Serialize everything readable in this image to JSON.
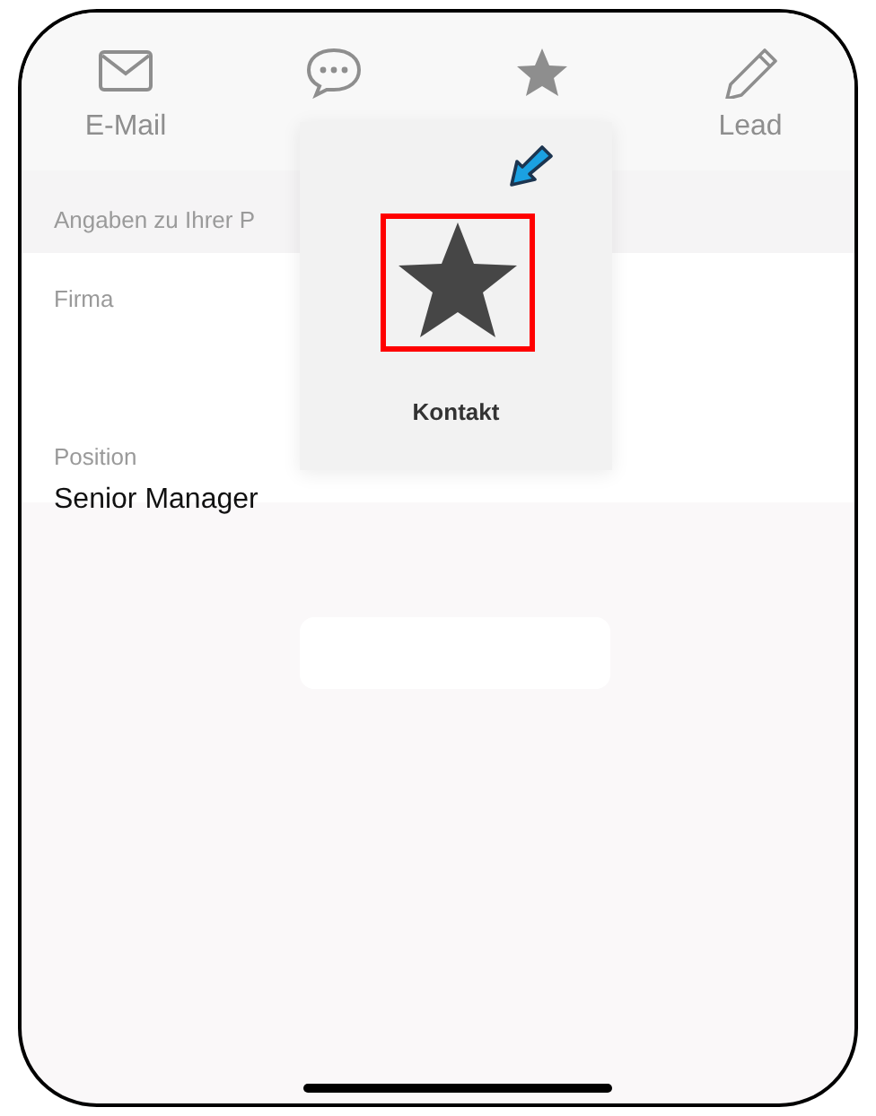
{
  "tabs": [
    {
      "kind": "mail",
      "label": "E-Mail"
    },
    {
      "kind": "chat"
    },
    {
      "kind": "star"
    },
    {
      "kind": "pencil",
      "label": "Lead"
    }
  ],
  "form": {
    "section": "Angaben zu Ihrer P",
    "fields": [
      {
        "label": "Firma"
      },
      {
        "label": "Position",
        "value": "Senior Manager"
      }
    ]
  },
  "popup": {
    "label": "Kontakt"
  }
}
